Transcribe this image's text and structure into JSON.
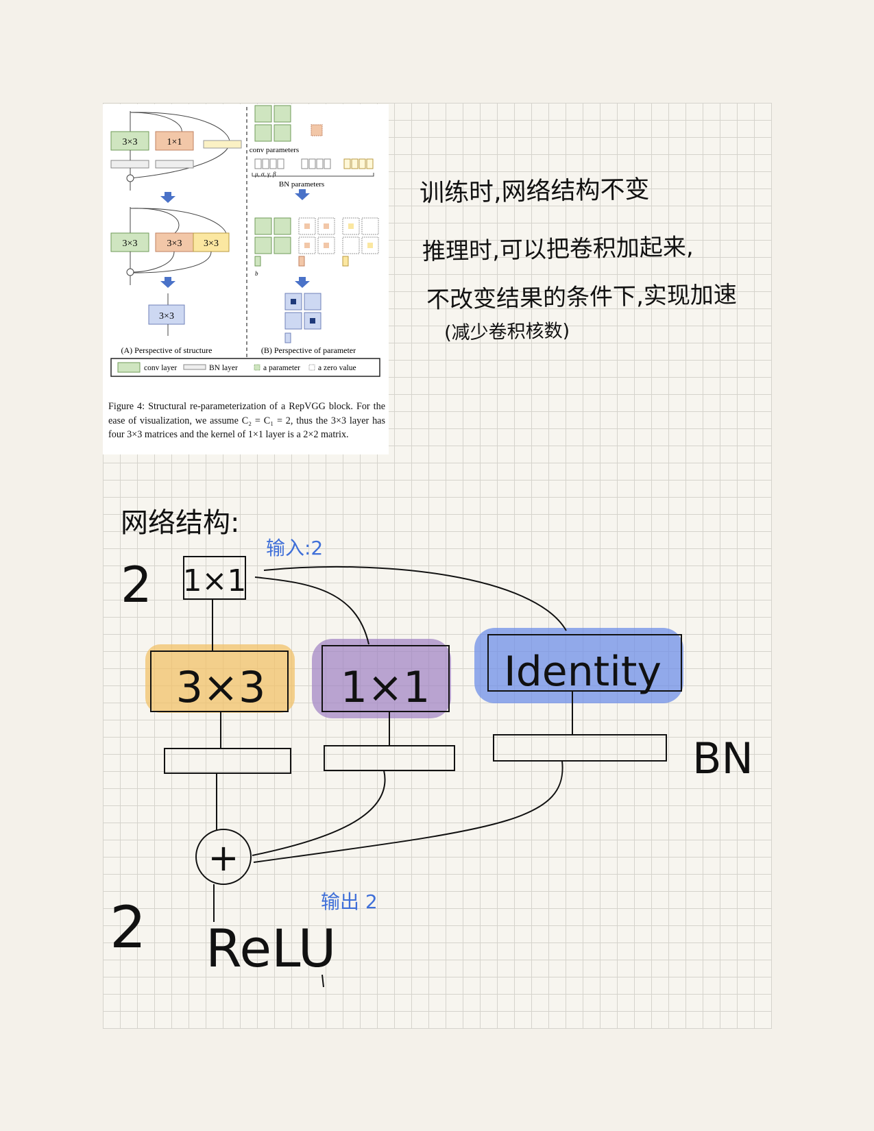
{
  "figure": {
    "structure_boxes_row1": [
      "3×3",
      "1×1"
    ],
    "structure_boxes_row2": [
      "3×3",
      "3×3",
      "3×3"
    ],
    "structure_box_final": "3×3",
    "conv_parameters_label": "conv parameters",
    "bn_params_symbols": "μ, σ, γ, β",
    "bn_parameters_label": "BN parameters",
    "b_label": "b",
    "caption_a": "(A) Perspective of structure",
    "caption_b": "(B) Perspective of parameter",
    "legend": {
      "conv_layer": "conv layer",
      "bn_layer": "BN layer",
      "a_parameter": "a parameter",
      "a_zero_value": "a zero value"
    },
    "caption_text": "Figure 4: Structural re-parameterization of a RepVGG block. For the ease of visualization, we assume C₂ = C₁ = 2, thus the 3×3 layer has four 3×3 matrices and the kernel of 1×1 layer is a 2×2 matrix.",
    "colors": {
      "conv": "#cfe5c0",
      "conv_border": "#6f9a58",
      "orange": "#f2c7a8",
      "yellow": "#fbe7a1",
      "blue": "#cdd8f2",
      "arrow": "#4a72c8"
    }
  },
  "notes": {
    "line1": "训练时,网络结构不变",
    "line2": "推理时,可以把卷积加起来,",
    "line3": "不改变结果的条件下,实现加速",
    "line4": "(减少卷积核数)"
  },
  "diagram": {
    "title": "网络结构:",
    "input_label": "输入:2",
    "output_label": "输出 2",
    "channels_in": "2",
    "channels_out": "2",
    "box_input": "1×1",
    "box_3x3": "3×3",
    "box_1x1": "1×1",
    "box_identity": "Identity",
    "bn_label": "BN",
    "add_symbol": "+",
    "relu_label": "ReLU",
    "colors": {
      "orange": "#f1c16a",
      "purple": "#a184c4",
      "blue": "#6f8fe8"
    }
  }
}
